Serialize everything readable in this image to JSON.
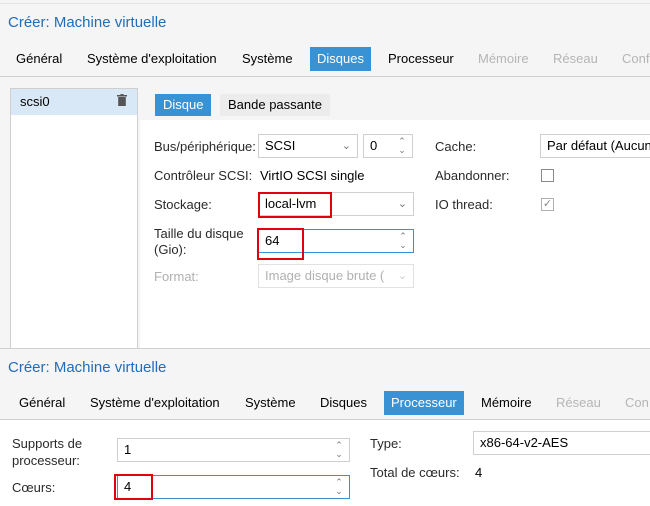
{
  "dialog1": {
    "title": "Créer: Machine virtuelle",
    "tabs": [
      "Général",
      "Système d'exploitation",
      "Système",
      "Disques",
      "Processeur",
      "Mémoire",
      "Réseau",
      "Conf"
    ],
    "active_tab": "Disques",
    "disk_list": {
      "selected": "scsi0",
      "delete_icon": "trash-icon"
    },
    "subtabs": [
      "Disque",
      "Bande passante"
    ],
    "form": {
      "bus_label": "Bus/périphérique:",
      "bus_value": "SCSI",
      "bus_index": "0",
      "controller_label": "Contrôleur SCSI:",
      "controller_value": "VirtIO SCSI single",
      "storage_label": "Stockage:",
      "storage_value": "local-lvm",
      "disk_size_label_1": "Taille du disque",
      "disk_size_label_2": "(Gio):",
      "disk_size_value": "64",
      "format_label": "Format:",
      "format_value": "Image disque brute (",
      "cache_label": "Cache:",
      "cache_value": "Par défaut (Aucun",
      "discard_label": "Abandonner:",
      "discard_checked": false,
      "iothread_label": "IO thread:",
      "iothread_checked": true
    }
  },
  "dialog2": {
    "title": "Créer: Machine virtuelle",
    "tabs": [
      "Général",
      "Système d'exploitation",
      "Système",
      "Disques",
      "Processeur",
      "Mémoire",
      "Réseau",
      "Con"
    ],
    "active_tab": "Processeur",
    "form": {
      "sockets_label_1": "Supports de",
      "sockets_label_2": "processeur:",
      "sockets_value": "1",
      "cores_label": "Cœurs:",
      "cores_value": "4",
      "type_label": "Type:",
      "type_value": "x86-64-v2-AES",
      "total_cores_label": "Total de cœurs:",
      "total_cores_value": "4"
    }
  },
  "colors": {
    "accent": "#3892d4",
    "title": "#1f6dbc",
    "highlight": "#e0000f"
  }
}
